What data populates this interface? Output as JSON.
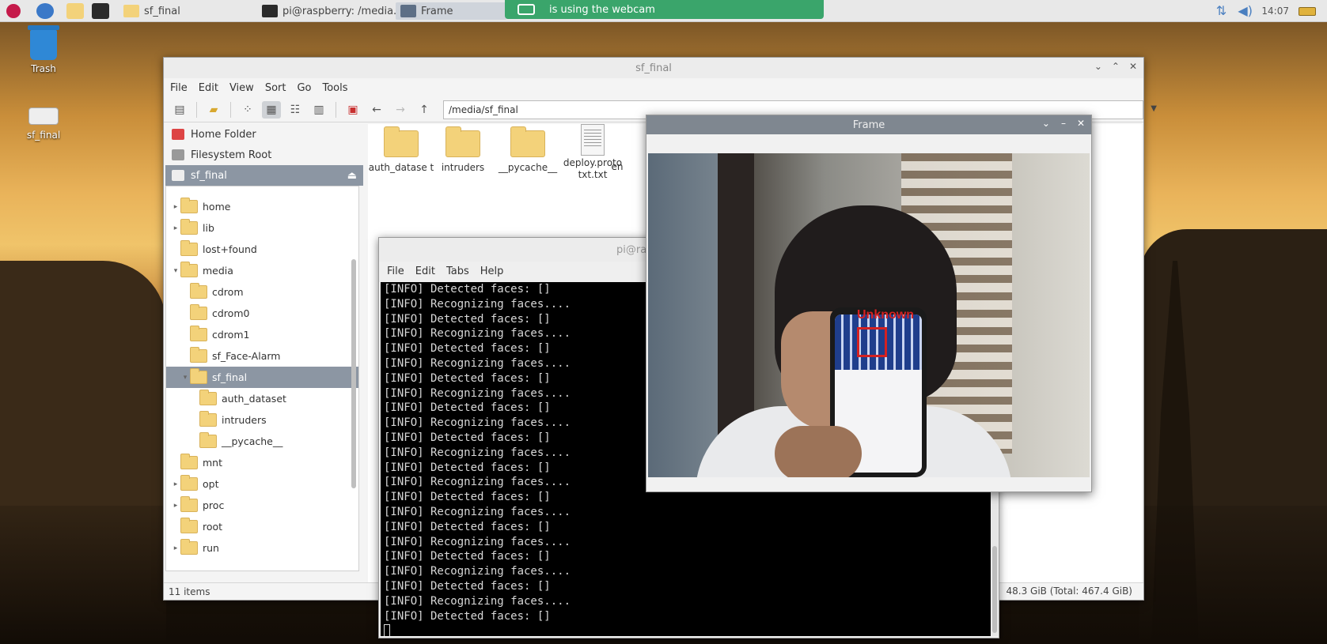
{
  "taskbar": {
    "tasks": [
      {
        "label": "sf_final"
      },
      {
        "label": "pi@raspberry: /media..."
      },
      {
        "label": "Frame"
      }
    ],
    "notification": "is using the webcam",
    "clock": "14:07"
  },
  "desktop": {
    "icons": [
      {
        "label": "Trash"
      },
      {
        "label": "sf_final"
      }
    ]
  },
  "file_manager": {
    "title": "sf_final",
    "menu": [
      "File",
      "Edit",
      "View",
      "Sort",
      "Go",
      "Tools"
    ],
    "path": "/media/sf_final",
    "places": [
      {
        "label": "Home Folder"
      },
      {
        "label": "Filesystem Root"
      },
      {
        "label": "sf_final"
      }
    ],
    "tree": [
      {
        "label": "home",
        "indent": 1,
        "arrow": "▸"
      },
      {
        "label": "lib",
        "indent": 1,
        "arrow": "▸"
      },
      {
        "label": "lost+found",
        "indent": 1,
        "arrow": ""
      },
      {
        "label": "media",
        "indent": 1,
        "arrow": "▾"
      },
      {
        "label": "cdrom",
        "indent": 2,
        "arrow": ""
      },
      {
        "label": "cdrom0",
        "indent": 2,
        "arrow": ""
      },
      {
        "label": "cdrom1",
        "indent": 2,
        "arrow": ""
      },
      {
        "label": "sf_Face-Alarm",
        "indent": 2,
        "arrow": ""
      },
      {
        "label": "sf_final",
        "indent": 2,
        "arrow": "▾",
        "selected": true
      },
      {
        "label": "auth_dataset",
        "indent": 3,
        "arrow": ""
      },
      {
        "label": "intruders",
        "indent": 3,
        "arrow": ""
      },
      {
        "label": "__pycache__",
        "indent": 3,
        "arrow": ""
      },
      {
        "label": "mnt",
        "indent": 1,
        "arrow": ""
      },
      {
        "label": "opt",
        "indent": 1,
        "arrow": "▸"
      },
      {
        "label": "proc",
        "indent": 1,
        "arrow": "▸"
      },
      {
        "label": "root",
        "indent": 1,
        "arrow": ""
      },
      {
        "label": "run",
        "indent": 1,
        "arrow": "▸"
      }
    ],
    "files": [
      {
        "label": "auth_datase t",
        "type": "folder"
      },
      {
        "label": "intruders",
        "type": "folder"
      },
      {
        "label": "__pycache__",
        "type": "folder"
      },
      {
        "label": "deploy.proto txt.txt",
        "type": "doc"
      },
      {
        "label": "en",
        "type": "partial"
      }
    ],
    "status_left": "11 items",
    "status_right": "48.3 GiB (Total: 467.4 GiB)"
  },
  "terminal": {
    "title": "pi@ra",
    "menu": [
      "File",
      "Edit",
      "Tabs",
      "Help"
    ],
    "lines": [
      "[INFO] Detected faces: []",
      "[INFO] Recognizing faces....",
      "[INFO] Detected faces: []",
      "[INFO] Recognizing faces....",
      "[INFO] Detected faces: []",
      "[INFO] Recognizing faces....",
      "[INFO] Detected faces: []",
      "[INFO] Recognizing faces....",
      "[INFO] Detected faces: []",
      "[INFO] Recognizing faces....",
      "[INFO] Detected faces: []",
      "[INFO] Recognizing faces....",
      "[INFO] Detected faces: []",
      "[INFO] Recognizing faces....",
      "[INFO] Detected faces: []",
      "[INFO] Recognizing faces....",
      "[INFO] Detected faces: []",
      "[INFO] Recognizing faces....",
      "[INFO] Detected faces: []",
      "[INFO] Recognizing faces....",
      "[INFO] Detected faces: []",
      "[INFO] Recognizing faces....",
      "[INFO] Detected faces: []"
    ]
  },
  "frame_window": {
    "title": "Frame",
    "label": "Unknown"
  }
}
